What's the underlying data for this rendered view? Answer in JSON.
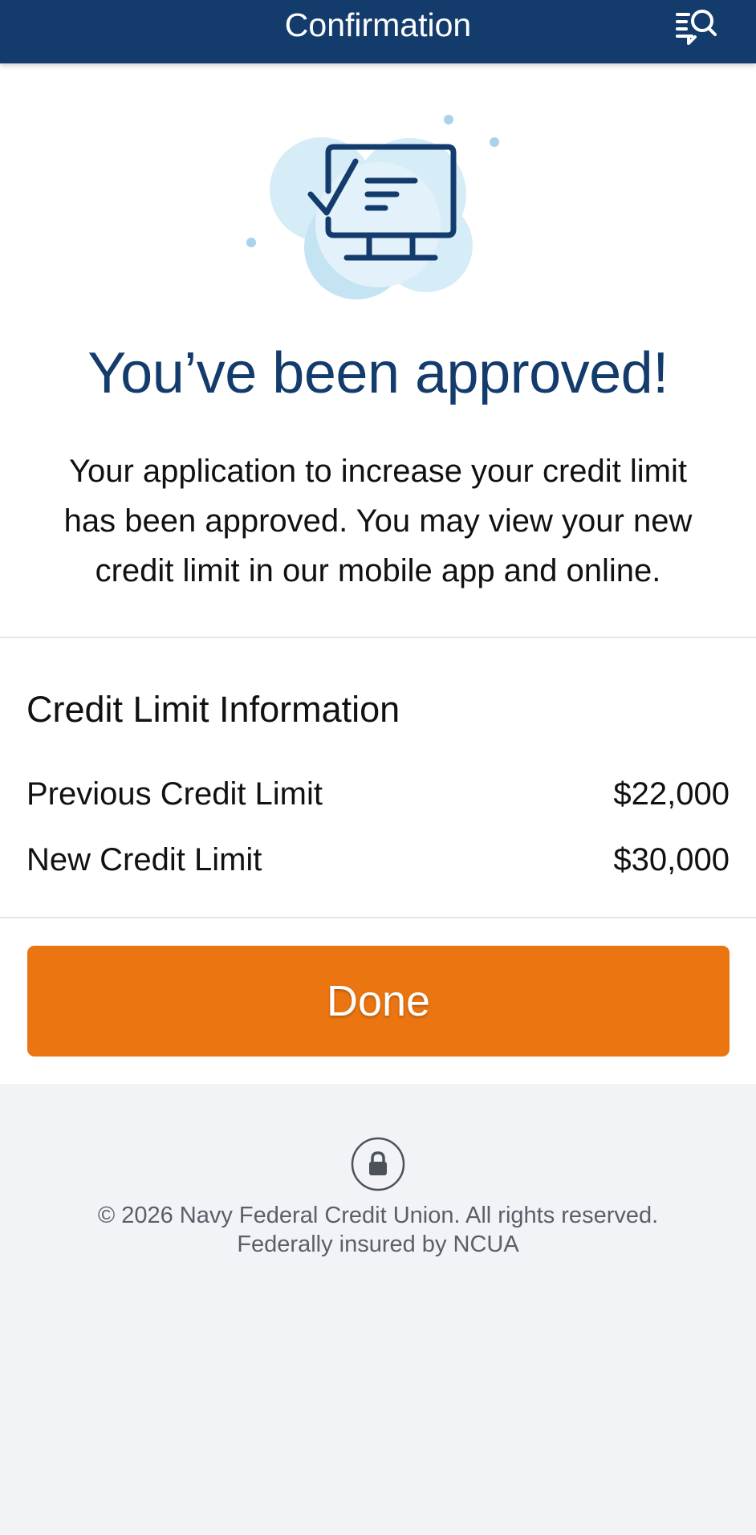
{
  "header": {
    "title": "Confirmation",
    "help_icon": "chat-help-icon"
  },
  "confirmation": {
    "illustration_icon": "monitor-checklist-icon",
    "headline": "You’ve been approved!",
    "message": "Your application to increase your credit limit has been approved. You may view your new credit limit in our mobile app and online."
  },
  "credit_info": {
    "title": "Credit Limit Information",
    "rows": [
      {
        "label": "Previous Credit Limit",
        "value": "$22,000"
      },
      {
        "label": "New Credit Limit",
        "value": "$30,000"
      }
    ]
  },
  "actions": {
    "done_label": "Done"
  },
  "footer": {
    "lock_icon": "lock-icon",
    "copyright": "© 2026 Navy Federal Credit Union. All rights reserved.",
    "insured": "Federally insured by NCUA"
  },
  "colors": {
    "header_bg": "#133c6d",
    "accent_orange": "#eb7510",
    "headline_blue": "#133c6d",
    "page_bg": "#f1f3f7"
  }
}
